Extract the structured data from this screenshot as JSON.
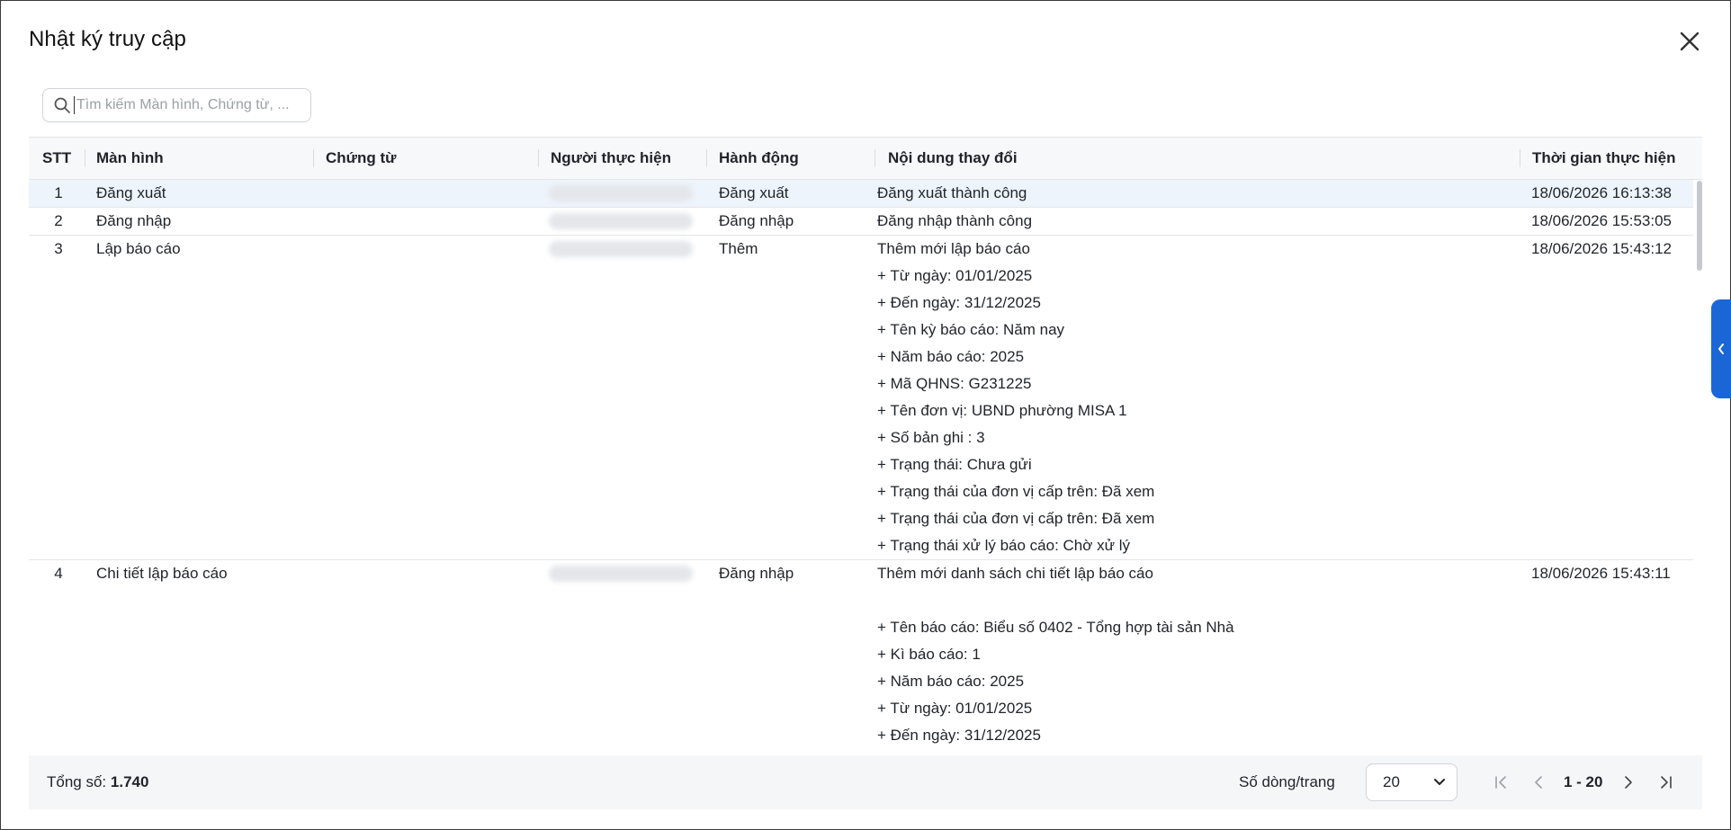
{
  "dialog": {
    "title": "Nhật ký truy cập"
  },
  "search": {
    "placeholder": "Tìm kiếm Màn hình, Chứng từ, ..."
  },
  "table": {
    "columns": [
      "STT",
      "Màn hình",
      "Chứng từ",
      "Người thực hiện",
      "Hành động",
      "Nội dung thay đổi",
      "Thời gian thực hiện"
    ],
    "rows": [
      {
        "stt": "1",
        "screen": "Đăng xuất",
        "document": "",
        "action": "Đăng xuất",
        "changes": [
          "Đăng xuất thành công"
        ],
        "time": "18/06/2026 16:13:38"
      },
      {
        "stt": "2",
        "screen": "Đăng nhập",
        "document": "",
        "action": "Đăng nhập",
        "changes": [
          "Đăng nhập thành công"
        ],
        "time": "18/06/2026 15:53:05"
      },
      {
        "stt": "3",
        "screen": "Lập báo cáo",
        "document": "",
        "action": "Thêm",
        "changes": [
          "Thêm mới lập báo cáo",
          "+ Từ ngày: 01/01/2025",
          "+ Đến ngày: 31/12/2025",
          "+ Tên kỳ báo cáo: Năm nay",
          "+ Năm báo cáo: 2025",
          "+ Mã QHNS: G231225",
          "+ Tên đơn vị: UBND phường MISA 1",
          "+ Số bản ghi : 3",
          "+ Trạng thái: Chưa gửi",
          "+ Trạng thái của đơn vị cấp trên: Đã xem",
          "+ Trạng thái của đơn vị cấp trên: Đã xem",
          "+ Trạng thái xử lý báo cáo: Chờ xử lý"
        ],
        "time": "18/06/2026 15:43:12"
      },
      {
        "stt": "4",
        "screen": "Chi tiết lập báo cáo",
        "document": "",
        "action": "Đăng nhập",
        "changes": [
          "Thêm mới danh sách chi tiết lập báo cáo",
          "",
          "+ Tên báo cáo: Biểu số 0402 - Tổng hợp tài sản Nhà",
          "+ Kì báo cáo: 1",
          "+ Năm báo cáo: 2025",
          "+ Từ ngày: 01/01/2025",
          "+ Đến ngày: 31/12/2025"
        ],
        "time": "18/06/2026 15:43:11"
      }
    ]
  },
  "footer": {
    "total_label": "Tổng số:",
    "total_value": "1.740",
    "rows_per_page_label": "Số dòng/trang",
    "rows_per_page_value": "20",
    "page_range": "1 - 20"
  },
  "icons": {
    "close": "close-icon",
    "search": "search-icon",
    "first_page": "first-page-icon",
    "prev_page": "chevron-left-icon",
    "next_page": "chevron-right-icon",
    "last_page": "last-page-icon",
    "side_toggle": "chevron-left-icon",
    "dropdown": "chevron-down-icon"
  },
  "colors": {
    "selected_row": "#eef4fc",
    "side_tab": "#1a66d6",
    "header_bg": "#f7f8fa",
    "footer_bg": "#f5f6f8"
  }
}
